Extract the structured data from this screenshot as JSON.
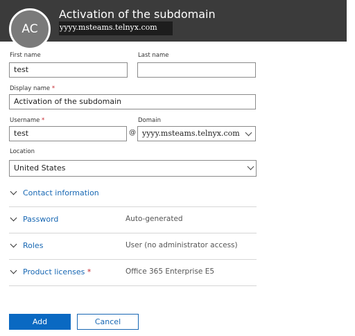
{
  "header": {
    "avatar_initials": "AC",
    "title": "Activation of the subdomain",
    "subtitle": "yyyy.msteams.telnyx.com"
  },
  "form": {
    "first_name": {
      "label": "First name",
      "value": "test"
    },
    "last_name": {
      "label": "Last name",
      "value": ""
    },
    "display_name": {
      "label": "Display name",
      "required_mark": "*",
      "value": "Activation of the subdomain"
    },
    "username": {
      "label": "Username",
      "required_mark": "*",
      "value": "test"
    },
    "at_sign": "@",
    "domain": {
      "label": "Domain",
      "value": "yyyy.msteams.telnyx.com"
    },
    "location": {
      "label": "Location",
      "value": "United States"
    }
  },
  "sections": [
    {
      "label": "Contact information",
      "value": "",
      "required_mark": ""
    },
    {
      "label": "Password",
      "value": "Auto-generated",
      "required_mark": ""
    },
    {
      "label": "Roles",
      "value": "User (no administrator access)",
      "required_mark": ""
    },
    {
      "label": "Product licenses",
      "value": "Office 365 Enterprise E5",
      "required_mark": "*"
    }
  ],
  "buttons": {
    "add": "Add",
    "cancel": "Cancel"
  },
  "colors": {
    "header_bg": "#3b3b3b",
    "accent": "#0a69c2",
    "link": "#1767b3",
    "required": "#c4262e"
  }
}
